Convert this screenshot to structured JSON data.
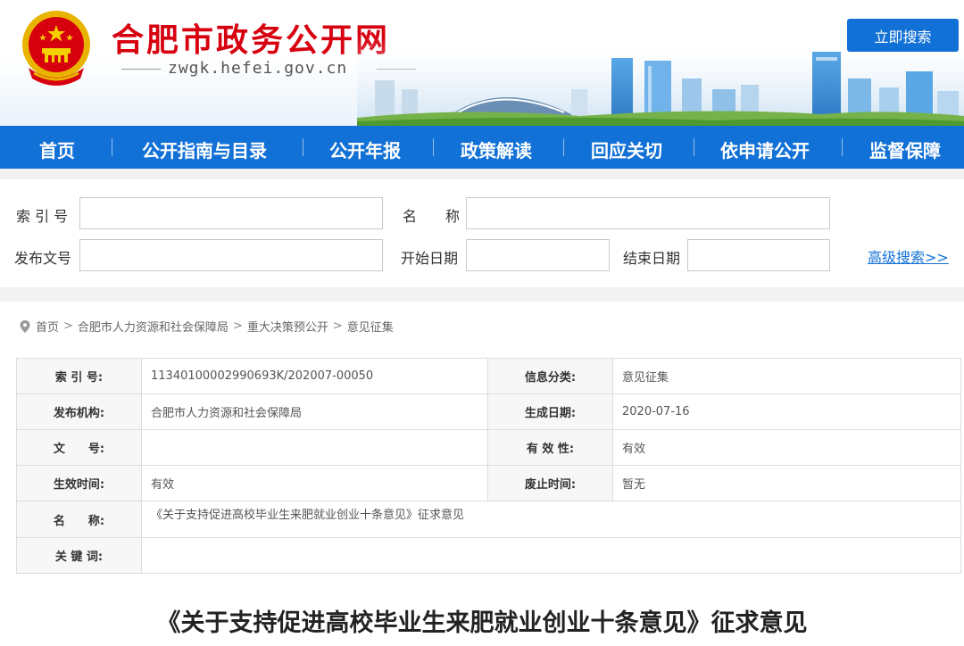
{
  "site": {
    "title": "合肥市政务公开网",
    "domain": "zwgk.hefei.gov.cn",
    "emblem_icon": "national-emblem",
    "brand_red": "#d7000f",
    "brand_blue": "#1271d6"
  },
  "nav": {
    "items": [
      {
        "label": "首页"
      },
      {
        "label": "公开指南与目录"
      },
      {
        "label": "公开年报"
      },
      {
        "label": "政策解读"
      },
      {
        "label": "回应关切"
      },
      {
        "label": "依申请公开"
      },
      {
        "label": "监督保障"
      }
    ]
  },
  "search": {
    "index_label": "索 引 号",
    "name_label": "名　　称",
    "doc_no_label": "发布文号",
    "start_date_label": "开始日期",
    "end_date_label": "结束日期",
    "index_value": "",
    "name_value": "",
    "doc_no_value": "",
    "start_date_value": "",
    "end_date_value": "",
    "search_button": "立即搜索",
    "advanced_link": "高级搜索>>"
  },
  "breadcrumb": {
    "icon": "location-pin-icon",
    "items": [
      "首页",
      "合肥市人力资源和社会保障局",
      "重大决策预公开",
      "意见征集"
    ],
    "separator": ">"
  },
  "meta": {
    "index_no_label": "索 引 号:",
    "index_no": "11340100002990693K/202007-00050",
    "category_label": "信息分类:",
    "category": "意见征集",
    "publisher_label": "发布机构:",
    "publisher": "合肥市人力资源和社会保障局",
    "created_label": "生成日期:",
    "created": "2020-07-16",
    "doc_no_label": "文　　号:",
    "doc_no": "",
    "validity_label": "有 效 性:",
    "validity": "有效",
    "effective_label": "生效时间:",
    "effective": "有效",
    "repeal_label": "废止时间:",
    "repeal": "暂无",
    "name_label": "名　　称:",
    "name": "《关于支持促进高校毕业生来肥就业创业十条意见》征求意见",
    "keywords_label": "关 键 词:",
    "keywords": ""
  },
  "document": {
    "title": "《关于支持促进高校毕业生来肥就业创业十条意见》征求意见"
  }
}
